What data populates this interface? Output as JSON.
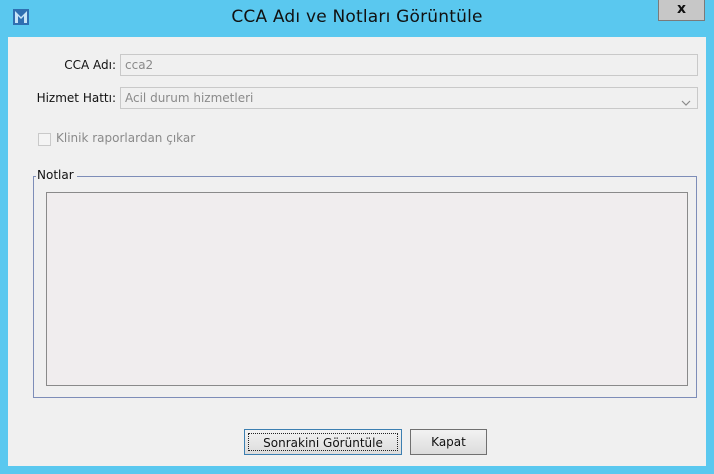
{
  "window": {
    "title": "CCA Adı ve Notları Görüntüle",
    "close_glyph": "x",
    "app_icon": "app-logo-icon",
    "colors": {
      "titlebar": "#5ac8ef",
      "client": "#f0f0f0",
      "icon": "#2f6fb1"
    }
  },
  "form": {
    "cca_label": "CCA Adı:",
    "cca_value": "cca2",
    "service_label": "Hizmet Hattı:",
    "service_value": "Acil durum hizmetleri",
    "service_icon": "chevron-down-icon",
    "exclude_checkbox_label": "Klinik raporlardan çıkar",
    "exclude_checked": false
  },
  "notes": {
    "legend": "Notlar",
    "value": ""
  },
  "buttons": {
    "next": "Sonrakini Görüntüle",
    "close": "Kapat"
  }
}
